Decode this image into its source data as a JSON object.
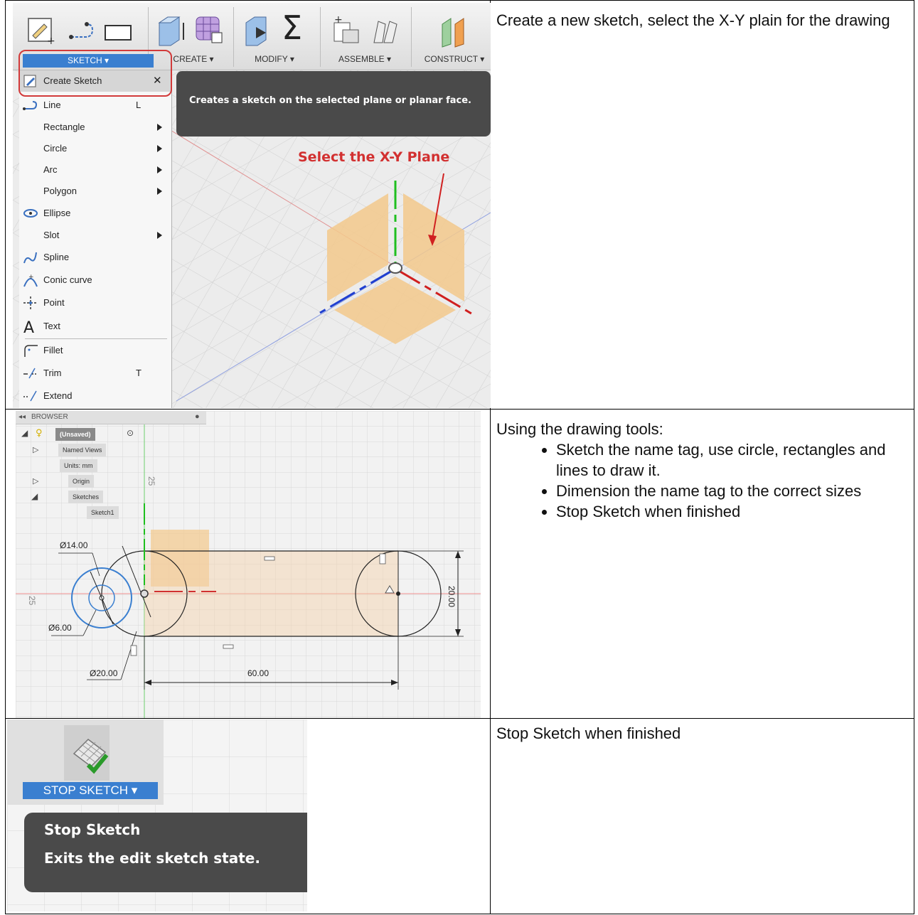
{
  "rows": [
    {
      "description": "Create a new sketch, select the X-Y plain for the drawing"
    },
    {
      "description_intro": "Using the drawing tools:",
      "bullets": [
        "Sketch the name tag, use circle, rectangles and lines to draw it.",
        "Dimension the name tag to the correct sizes",
        "Stop Sketch when finished"
      ]
    },
    {
      "description": "Stop Sketch when finished"
    }
  ],
  "toolbar": {
    "sketch": "SKETCH ▾",
    "create": "CREATE ▾",
    "modify": "MODIFY ▾",
    "assemble": "ASSEMBLE ▾",
    "construct": "CONSTRUCT ▾"
  },
  "sketch_menu": {
    "items": [
      {
        "label": "Create Sketch",
        "shortcut": "✕",
        "icon": "create-sketch-icon"
      },
      {
        "label": "Line",
        "shortcut": "L",
        "icon": "line-icon"
      },
      {
        "label": "Rectangle",
        "submenu": true
      },
      {
        "label": "Circle",
        "submenu": true
      },
      {
        "label": "Arc",
        "submenu": true
      },
      {
        "label": "Polygon",
        "submenu": true
      },
      {
        "label": "Ellipse",
        "icon": "ellipse-icon"
      },
      {
        "label": "Slot",
        "submenu": true
      },
      {
        "label": "Spline",
        "icon": "spline-icon"
      },
      {
        "label": "Conic curve",
        "icon": "conic-curve-icon"
      },
      {
        "label": "Point",
        "icon": "point-icon"
      },
      {
        "label": "Text",
        "icon": "text-icon"
      },
      {
        "label": "Fillet",
        "icon": "fillet-icon"
      },
      {
        "label": "Trim",
        "shortcut": "T",
        "icon": "trim-icon"
      },
      {
        "label": "Extend",
        "icon": "extend-icon"
      }
    ]
  },
  "tooltip_create_sketch": "Creates a sketch on the selected plane or planar face.",
  "annotation_xy": "Select the X-Y Plane",
  "browser": {
    "header": "BROWSER",
    "nodes": [
      "(Unsaved)",
      "Named Views",
      "Units: mm",
      "Origin",
      "Sketches",
      "Sketch1"
    ]
  },
  "sketch_dims": {
    "d14": "Ø14.00",
    "d6": "Ø6.00",
    "d20": "Ø20.00",
    "len": "60.00",
    "height": "20.00",
    "grid_label": "25"
  },
  "stop_sketch": {
    "button": "STOP SKETCH ▾",
    "tooltip_title": "Stop Sketch",
    "tooltip_body": "Exits the edit sketch state."
  },
  "colors": {
    "accent_blue": "#3a7fd0",
    "highlight_red": "#d23a3a",
    "plane_orange": "#f3c98c",
    "tooltip_bg": "#4a4a4a"
  }
}
